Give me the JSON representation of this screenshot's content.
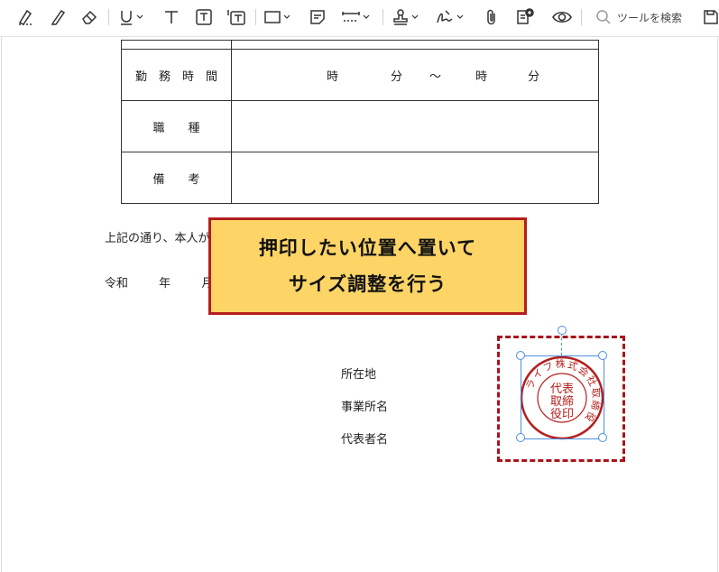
{
  "toolbar": {
    "icons": [
      "highlight-area-icon",
      "pencil-icon",
      "eraser-icon",
      "underline-icon",
      "text-icon",
      "textbox-icon",
      "text-field-icon",
      "rectangle-icon",
      "sticky-note-icon",
      "measure-icon",
      "stamp-icon",
      "signature-icon",
      "attach-icon",
      "add-comment-icon",
      "eye-icon",
      "save-icon"
    ],
    "search_label": "ツールを検索"
  },
  "form_table": {
    "rows": [
      {
        "label": "勤　務　時　間",
        "time_parts": [
          "時",
          "分",
          "～",
          "時",
          "分"
        ]
      },
      {
        "label": "職　　種",
        "value": ""
      },
      {
        "label": "備　　考",
        "value": ""
      }
    ]
  },
  "body": {
    "certification_text": "上記の通り、本人が当社に在籍していることを証明します。",
    "date_parts": [
      "令和",
      "年",
      "月"
    ],
    "fields": [
      "所在地",
      "事業所名",
      "代表者名"
    ]
  },
  "callout": {
    "line1": "押印したい位置へ置いて",
    "line2": "サイズ調整を行う"
  },
  "seal": {
    "ring_text": "ライフ株式会社取締役",
    "center_text": [
      "代表",
      "取締",
      "役印"
    ],
    "color": "#b41e1e"
  },
  "colors": {
    "accent_border": "#b41e1e",
    "callout_fill": "#fdd466",
    "selection": "#4a90e2"
  }
}
